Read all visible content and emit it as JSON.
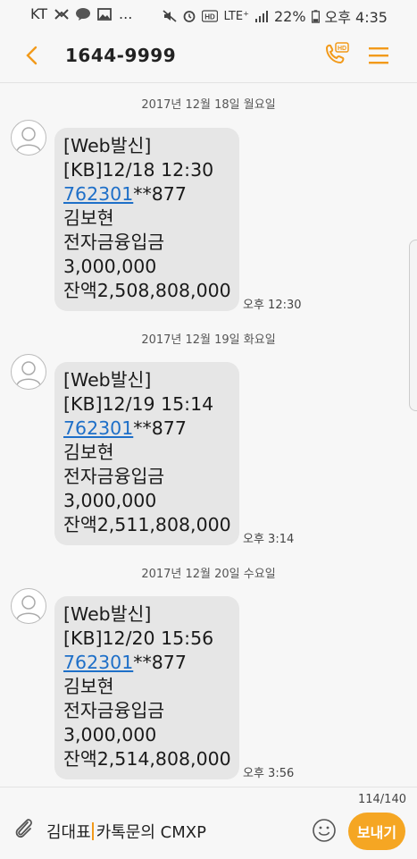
{
  "statusbar": {
    "carrier": "KT",
    "dots": "...",
    "network": "LTE⁺",
    "battery": "22%",
    "time": "오후 4:35",
    "icons": [
      "notification-icon",
      "talk-icon",
      "gallery-icon",
      "mute-icon",
      "alarm-icon",
      "hd-icon",
      "signal-icon",
      "battery-icon"
    ]
  },
  "header": {
    "title": "1644-9999",
    "call_badge": "HD"
  },
  "messages": [
    {
      "date": "2017년 12월 18일 월요일",
      "lines": [
        "[Web발신]",
        "[KB]12/18 12:30",
        "",
        "김보현",
        "전자금융입금",
        "3,000,000",
        "잔액2,508,808,000"
      ],
      "account_link": "762301",
      "account_rest": "**877",
      "time": "오후 12:30"
    },
    {
      "date": "2017년 12월 19일 화요일",
      "lines": [
        "[Web발신]",
        "[KB]12/19 15:14",
        "",
        "김보현",
        "전자금융입금",
        "3,000,000",
        "잔액2,511,808,000"
      ],
      "account_link": "762301",
      "account_rest": "**877",
      "time": "오후 3:14"
    },
    {
      "date": "2017년 12월 20일 수요일",
      "lines": [
        "[Web발신]",
        "[KB]12/20 15:56",
        "",
        "김보현",
        "전자금융입금",
        "3,000,000",
        "잔액2,514,808,000"
      ],
      "account_link": "762301",
      "account_rest": "**877",
      "time": "오후 3:56"
    }
  ],
  "composer": {
    "counter": "114/140",
    "text_before_cursor": "김대표",
    "text_after_cursor": "카톡문의 CMXP",
    "send_label": "보내기"
  },
  "colors": {
    "accent": "#f5a623",
    "link": "#1e6fc8",
    "bubble": "#e6e6e6",
    "background": "#f7f7f7"
  }
}
